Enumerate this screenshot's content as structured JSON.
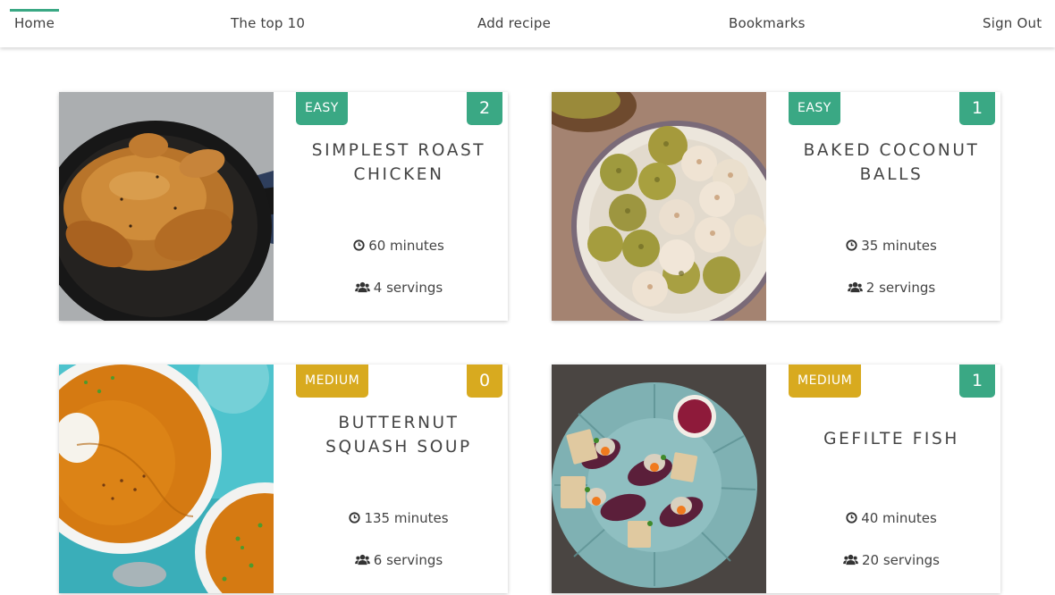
{
  "nav": {
    "items": [
      {
        "id": "home",
        "label": "Home",
        "active": true
      },
      {
        "id": "top10",
        "label": "The top 10",
        "active": false
      },
      {
        "id": "add",
        "label": "Add recipe",
        "active": false
      },
      {
        "id": "bookmarks",
        "label": "Bookmarks",
        "active": false
      },
      {
        "id": "signout",
        "label": "Sign Out",
        "active": false
      }
    ],
    "accent_color": "#3aa884"
  },
  "recipes": [
    {
      "difficulty": "EASY",
      "difficulty_color": "#3aa884",
      "count": "2",
      "count_color": "#3aa884",
      "title_lines": [
        "SIMPLEST ROAST",
        "CHICKEN"
      ],
      "time": "60 minutes",
      "servings": "4 servings",
      "image": "roast-chicken-image"
    },
    {
      "difficulty": "EASY",
      "difficulty_color": "#3aa884",
      "count": "1",
      "count_color": "#3aa884",
      "title_lines": [
        "BAKED COCONUT",
        "BALLS"
      ],
      "time": "35 minutes",
      "servings": "2 servings",
      "image": "coconut-balls-image"
    },
    {
      "difficulty": "MEDIUM",
      "difficulty_color": "#d8aa1f",
      "count": "0",
      "count_color": "#d8aa1f",
      "title_lines": [
        "BUTTERNUT",
        "SQUASH SOUP"
      ],
      "time": "135 minutes",
      "servings": "6 servings",
      "image": "squash-soup-image"
    },
    {
      "difficulty": "MEDIUM",
      "difficulty_color": "#d8aa1f",
      "count": "1",
      "count_color": "#3aa884",
      "title_lines": [
        "GEFILTE FISH"
      ],
      "time": "40 minutes",
      "servings": "20 servings",
      "image": "gefilte-fish-image"
    }
  ],
  "icons": {
    "time": "clock-icon",
    "servings": "users-icon"
  }
}
